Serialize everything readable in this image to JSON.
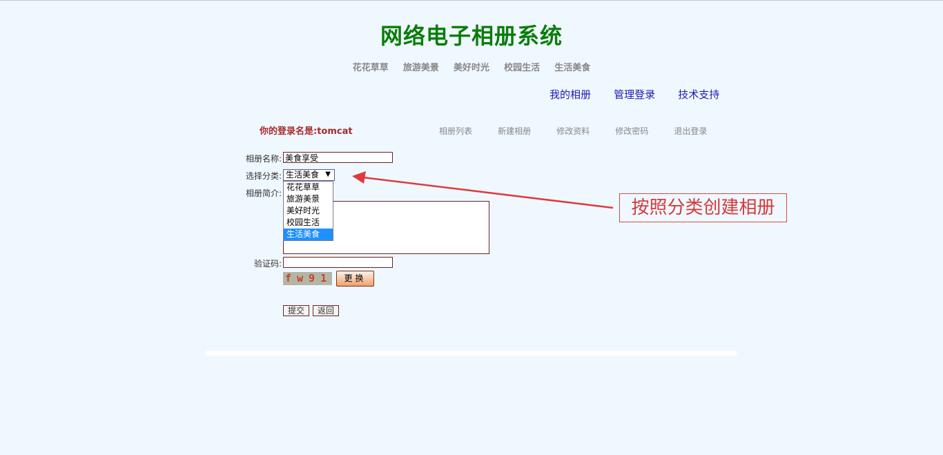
{
  "header": {
    "title": "网络电子相册系统",
    "categories": [
      "花花草草",
      "旅游美景",
      "美好时光",
      "校园生活",
      "生活美食"
    ]
  },
  "top_links": [
    "我的相册",
    "管理登录",
    "技术支持"
  ],
  "user": {
    "login_label": "你的登录名是:tomcat",
    "menu": [
      "相册列表",
      "新建相册",
      "修改资料",
      "修改密码",
      "退出登录"
    ]
  },
  "form": {
    "album_name_label": "相册名称:",
    "album_name_value": "美食享受",
    "category_label": "选择分类:",
    "category_selected": "生活美食",
    "category_options": [
      "花花草草",
      "旅游美景",
      "美好时光",
      "校园生活",
      "生活美食"
    ],
    "description_label": "相册简介:",
    "description_value": "美食享受",
    "captcha_label": "验证码:",
    "captcha_value": "",
    "captcha_text": "fw91",
    "refresh_label": "更换",
    "submit_label": "提交",
    "back_label": "返回"
  },
  "annotation": {
    "text": "按照分类创建相册",
    "color": "#e0393c"
  },
  "colors": {
    "title": "#0a7d0a",
    "link": "#1a1ab5",
    "login_name": "#a52a2a",
    "background": "#f0f8ff",
    "selected_option": "#1e90ff"
  }
}
